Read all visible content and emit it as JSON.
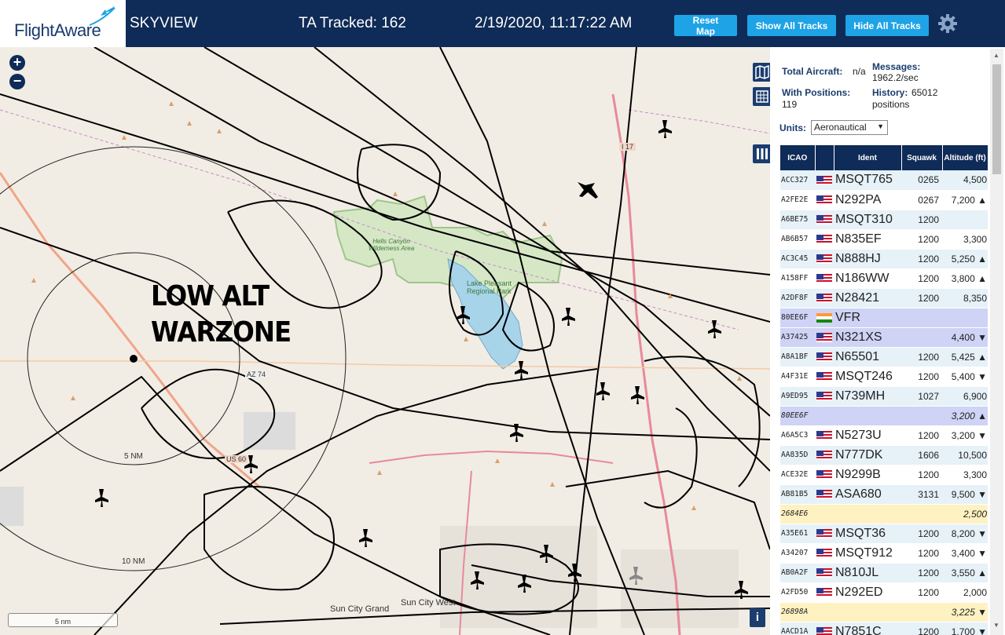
{
  "header": {
    "logo_text": "FlightAware",
    "site_name": "SKYVIEW",
    "tracked": "TA Tracked: 162",
    "datetime": "2/19/2020, 11:17:22 AM",
    "buttons": {
      "reset": "Reset Map",
      "show_all": "Show All Tracks",
      "hide_all": "Hide All Tracks"
    }
  },
  "map": {
    "overlay_text_line1": "LOW ALT",
    "overlay_text_line2": "WARZONE",
    "zoom_in": "+",
    "zoom_out": "−",
    "labels": {
      "range_5": "5 NM",
      "range_10": "10 NM",
      "wilderness": "Hells Canyon Wilderness Area",
      "lake": "Lake Pleasant Regional Park",
      "sun_city_grand": "Sun City Grand",
      "sun_city_west": "Sun City West",
      "az74": "AZ 74",
      "us60": "US 60",
      "i17": "I 17",
      "scale": "5 nm"
    },
    "info": "i"
  },
  "panel": {
    "total_aircraft_label": "Total Aircraft:",
    "total_aircraft_value": "n/a",
    "messages_label": "Messages:",
    "messages_value": "1962.2/sec",
    "with_positions_label": "With Positions:",
    "with_positions_value": "119",
    "history_label": "History:",
    "history_value": "65012",
    "history_unit": "positions",
    "units_label": "Units:",
    "units_value": "Aeronautical",
    "columns": [
      "ICAO",
      "",
      "Ident",
      "Squawk",
      "Altitude (ft)"
    ],
    "rows": [
      {
        "icao": "ACC327",
        "flag": "us",
        "ident": "MSQT765",
        "squawk": "0265",
        "alt": "4,500",
        "style": "r1"
      },
      {
        "icao": "A2FE2E",
        "flag": "us",
        "ident": "N292PA",
        "squawk": "0267",
        "alt": "7,200 ▲",
        "style": "r0"
      },
      {
        "icao": "A6BE75",
        "flag": "us",
        "ident": "MSQT310",
        "squawk": "1200",
        "alt": "",
        "style": "r1"
      },
      {
        "icao": "AB6B57",
        "flag": "us",
        "ident": "N835EF",
        "squawk": "1200",
        "alt": "3,300",
        "style": "r0"
      },
      {
        "icao": "AC3C45",
        "flag": "us",
        "ident": "N888HJ",
        "squawk": "1200",
        "alt": "5,250 ▲",
        "style": "r1"
      },
      {
        "icao": "A158FF",
        "flag": "us",
        "ident": "N186WW",
        "squawk": "1200",
        "alt": "3,800 ▲",
        "style": "r0"
      },
      {
        "icao": "A2DF8F",
        "flag": "us",
        "ident": "N28421",
        "squawk": "1200",
        "alt": "8,350",
        "style": "r1"
      },
      {
        "icao": "80EE6F",
        "flag": "in",
        "ident": "VFR",
        "squawk": "",
        "alt": "",
        "style": "rsel"
      },
      {
        "icao": "A37425",
        "flag": "us",
        "ident": "N321XS",
        "squawk": "",
        "alt": "4,400 ▼",
        "style": "rsel"
      },
      {
        "icao": "A8A1BF",
        "flag": "us",
        "ident": "N65501",
        "squawk": "1200",
        "alt": "5,425 ▲",
        "style": "r1"
      },
      {
        "icao": "A4F31E",
        "flag": "us",
        "ident": "MSQT246",
        "squawk": "1200",
        "alt": "5,400 ▼",
        "style": "r0"
      },
      {
        "icao": "A9ED95",
        "flag": "us",
        "ident": "N739MH",
        "squawk": "1027",
        "alt": "6,900",
        "style": "r1"
      },
      {
        "icao": "80EE6F",
        "flag": "",
        "ident": "",
        "squawk": "",
        "alt": "3,200 ▲",
        "style": "rsel",
        "italic": true
      },
      {
        "icao": "A6A5C3",
        "flag": "us",
        "ident": "N5273U",
        "squawk": "1200",
        "alt": "3,200 ▼",
        "style": "r0"
      },
      {
        "icao": "AA835D",
        "flag": "us",
        "ident": "N777DK",
        "squawk": "1606",
        "alt": "10,500",
        "style": "r1"
      },
      {
        "icao": "ACE32E",
        "flag": "us",
        "ident": "N9299B",
        "squawk": "1200",
        "alt": "3,300",
        "style": "r0"
      },
      {
        "icao": "AB81B5",
        "flag": "us",
        "ident": "ASA680",
        "squawk": "3131",
        "alt": "9,500 ▼",
        "style": "r1"
      },
      {
        "icao": "2684E6",
        "flag": "",
        "ident": "",
        "squawk": "",
        "alt": "2,500",
        "style": "rpend",
        "italic": true
      },
      {
        "icao": "A35E61",
        "flag": "us",
        "ident": "MSQT36",
        "squawk": "1200",
        "alt": "8,200 ▼",
        "style": "r1"
      },
      {
        "icao": "A34207",
        "flag": "us",
        "ident": "MSQT912",
        "squawk": "1200",
        "alt": "3,400 ▼",
        "style": "r0"
      },
      {
        "icao": "AB0A2F",
        "flag": "us",
        "ident": "N810JL",
        "squawk": "1200",
        "alt": "3,550 ▲",
        "style": "r1"
      },
      {
        "icao": "A2FD50",
        "flag": "us",
        "ident": "N292ED",
        "squawk": "1200",
        "alt": "2,000",
        "style": "r0"
      },
      {
        "icao": "26898A",
        "flag": "",
        "ident": "",
        "squawk": "",
        "alt": "3,225 ▼",
        "style": "rpend",
        "italic": true
      },
      {
        "icao": "AACD1A",
        "flag": "us",
        "ident": "N7851C",
        "squawk": "1200",
        "alt": "1,700 ▼",
        "style": "r1"
      }
    ]
  },
  "colors": {
    "header_bg": "#0f2b57",
    "button_bg": "#1ea3e6",
    "map_bg": "#f1ede4"
  }
}
